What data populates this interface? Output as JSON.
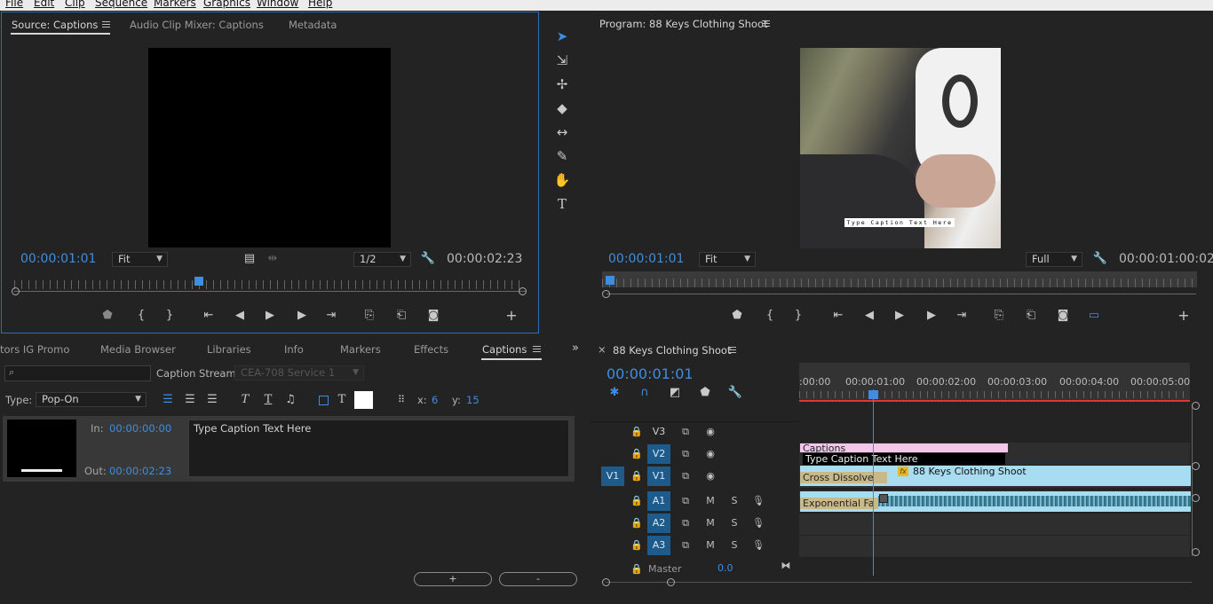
{
  "menu": [
    "File",
    "Edit",
    "Clip",
    "Sequence",
    "Markers",
    "Graphics",
    "Window",
    "Help"
  ],
  "source": {
    "tabs": [
      "Source: Captions",
      "Audio Clip Mixer: Captions",
      "Metadata"
    ],
    "timecode": "00:00:01:01",
    "fit": "Fit",
    "resolution": "1/2",
    "duration": "00:00:02:23"
  },
  "program": {
    "title": "Program: 88 Keys Clothing Shoot",
    "caption_overlay": "Type Caption Text Here",
    "timecode": "00:00:01:01",
    "fit": "Fit",
    "resolution": "Full",
    "duration": "00:00:01:00:02"
  },
  "project": {
    "tabs": [
      "tors IG Promo",
      "Media Browser",
      "Libraries",
      "Info",
      "Markers",
      "Effects",
      "Captions"
    ],
    "caption_stream_label": "Caption Stream:",
    "caption_stream_value": "CEA-708 Service 1",
    "type_label": "Type:",
    "type_value": "Pop-On",
    "x_label": "x:",
    "x_value": "6",
    "y_label": "y:",
    "y_value": "15",
    "in_label": "In:",
    "in_value": "00:00:00:00",
    "out_label": "Out:",
    "out_value": "00:00:02:23",
    "caption_text": "Type Caption Text Here",
    "add_label": "+",
    "remove_label": "-"
  },
  "timeline": {
    "title": "88 Keys Clothing Shoot",
    "timecode": "00:00:01:01",
    "ruler": [
      ":00:00",
      "00:00:01:00",
      "00:00:02:00",
      "00:00:03:00",
      "00:00:04:00",
      "00:00:05:00"
    ],
    "video_tracks": [
      "V3",
      "V2",
      "V1"
    ],
    "source_patch": "V1",
    "audio_tracks": [
      "A1",
      "A2",
      "A3"
    ],
    "master_label": "Master",
    "master_value": "0.0",
    "mute": "M",
    "solo": "S",
    "clips": {
      "captions": "Captions",
      "caption_text": "Type Caption Text Here",
      "cross_dissolve": "Cross Dissolve",
      "video_clip": "88 Keys Clothing Shoot",
      "fx": "fx",
      "audio_transition": "Exponential Fa"
    }
  },
  "colors": {
    "accent": "#3f8de0",
    "video_clip": "#a8dcf0",
    "caption_clip": "#f3c6ea",
    "track_on": "#1f5b8a"
  }
}
